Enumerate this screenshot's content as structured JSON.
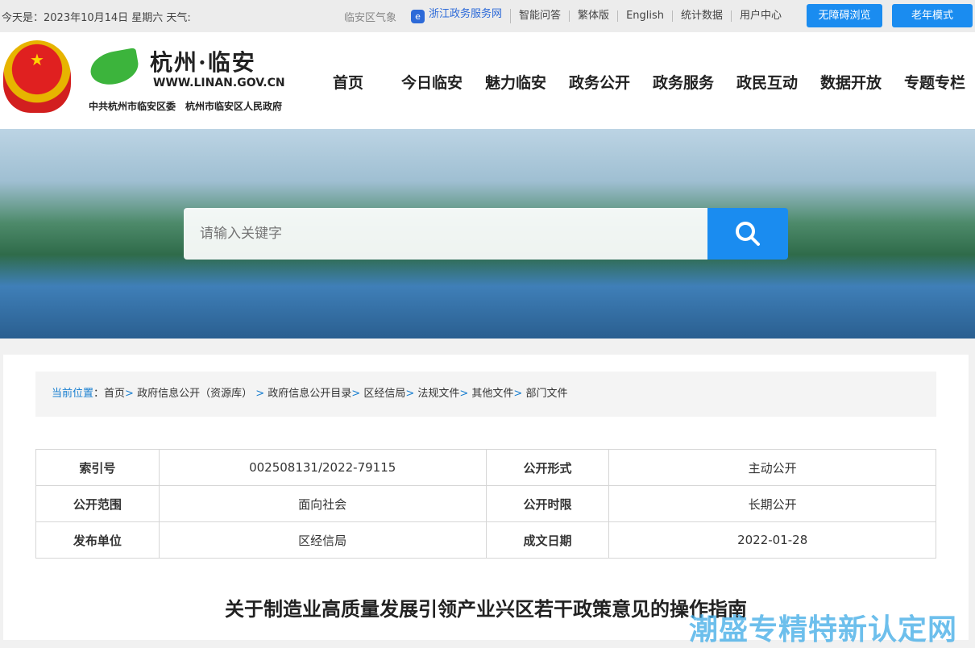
{
  "topbar": {
    "date": "今天是：2023年10月14日 星期六 天气:",
    "weather": "临安区气象",
    "links": [
      "浙江政务服务网",
      "智能问答",
      "繁体版",
      "English",
      "统计数据",
      "用户中心"
    ],
    "accessible": "无障碍浏览",
    "elder": "老年模式"
  },
  "header": {
    "logo_title": "杭州·临安",
    "logo_url": "WWW.LINAN.GOV.CN",
    "logo_sub": "中共杭州市临安区委　杭州市临安区人民政府",
    "nav": [
      "首页",
      "今日临安",
      "魅力临安",
      "政务公开",
      "政务服务",
      "政民互动",
      "数据开放",
      "专题专栏"
    ]
  },
  "search": {
    "placeholder": "请输入关键字"
  },
  "breadcrumb": {
    "label": "当前位置",
    "items": [
      "首页",
      "政府信息公开（资源库）",
      "政府信息公开目录",
      "区经信局",
      "法规文件",
      "其他文件",
      "部门文件"
    ]
  },
  "info": {
    "rows": [
      [
        "索引号",
        "002508131/2022-79115",
        "公开形式",
        "主动公开"
      ],
      [
        "公开范围",
        "面向社会",
        "公开时限",
        "长期公开"
      ],
      [
        "发布单位",
        "区经信局",
        "成文日期",
        "2022-01-28"
      ]
    ]
  },
  "article": {
    "title": "关于制造业高质量发展引领产业兴区若干政策意见的操作指南"
  },
  "watermark": "潮盛专精特新认定网",
  "colors": {
    "accent": "#1a8cf0",
    "breadcrumb": "#1a7fd0"
  }
}
